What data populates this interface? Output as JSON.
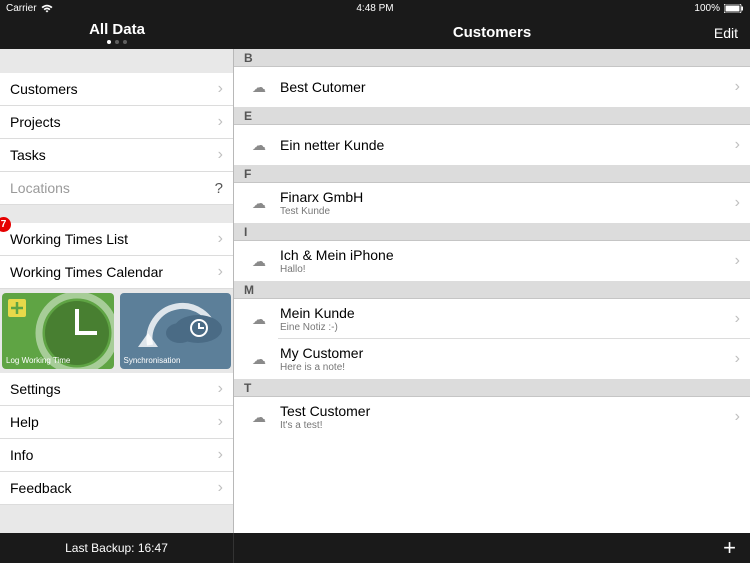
{
  "status": {
    "carrier": "Carrier",
    "time": "4:48 PM",
    "battery": "100%"
  },
  "nav": {
    "left_title": "All Data",
    "right_title": "Customers",
    "edit": "Edit"
  },
  "sidebar": {
    "items": [
      {
        "label": "Customers"
      },
      {
        "label": "Projects"
      },
      {
        "label": "Tasks"
      },
      {
        "label": "Locations",
        "disabled": true,
        "help": true
      }
    ],
    "items2": [
      {
        "label": "Working Times List",
        "badge": "7"
      },
      {
        "label": "Working Times Calendar"
      }
    ],
    "tiles": [
      {
        "label": "Log Working Time"
      },
      {
        "label": "Synchronisation"
      }
    ],
    "items3": [
      {
        "label": "Settings"
      },
      {
        "label": "Help"
      },
      {
        "label": "Info"
      },
      {
        "label": "Feedback"
      }
    ]
  },
  "customers": {
    "sections": [
      {
        "letter": "B",
        "rows": [
          {
            "title": "Best Cutomer",
            "sub": ""
          }
        ]
      },
      {
        "letter": "E",
        "rows": [
          {
            "title": "Ein netter Kunde",
            "sub": ""
          }
        ]
      },
      {
        "letter": "F",
        "rows": [
          {
            "title": "Finarx GmbH",
            "sub": "Test Kunde"
          }
        ]
      },
      {
        "letter": "I",
        "rows": [
          {
            "title": "Ich & Mein iPhone",
            "sub": "Hallo!"
          }
        ]
      },
      {
        "letter": "M",
        "rows": [
          {
            "title": "Mein Kunde",
            "sub": "Eine Notiz :-)"
          },
          {
            "title": "My Customer",
            "sub": "Here is a note!"
          }
        ]
      },
      {
        "letter": "T",
        "rows": [
          {
            "title": "Test Customer",
            "sub": "It's a test!"
          }
        ]
      }
    ]
  },
  "toolbar": {
    "backup": "Last Backup: 16:47",
    "add": "+"
  }
}
